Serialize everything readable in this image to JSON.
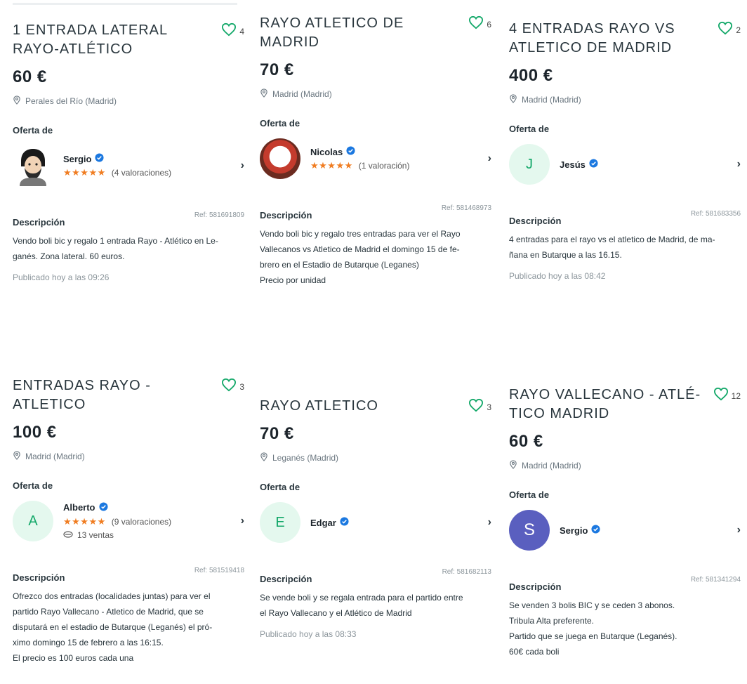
{
  "listings": [
    {
      "title": "1 ENTRADA LATERAL RAYO-ATLÉTICO",
      "favorites": "4",
      "price": "60 €",
      "location": "Perales del Río (Madrid)",
      "offer_label": "Oferta de",
      "seller": {
        "name": "Sergio",
        "avatar_letter": "",
        "avatar_icon": "user-photo",
        "stars": "★★★★★",
        "ratings": "(4 valoraciones)",
        "sales": ""
      },
      "description_label": "Descripción",
      "ref": "Ref: 581691809",
      "description": "Vendo boli bic y regalo 1 entrada Rayo - Atlético en Le-\nganés. Zona lateral. 60 euros.",
      "published": "Publicado hoy a las 09:26"
    },
    {
      "title": "RAYO ATLETICO DE MADRID",
      "favorites": "6",
      "price": "70 €",
      "location": "Madrid (Madrid)",
      "offer_label": "Oferta de",
      "seller": {
        "name": "Nicolas",
        "avatar_letter": "",
        "avatar_icon": "jersey-photo",
        "stars": "★★★★★",
        "ratings": "(1 valoración)",
        "sales": ""
      },
      "description_label": "Descripción",
      "ref": "Ref: 581468973",
      "description": "Vendo boli bic y regalo tres entradas para ver el Rayo\nVallecanos vs Atletico de Madrid el domingo 15 de fe-\nbrero en el Estadio de Butarque (Leganes)\nPrecio por unidad",
      "published": ""
    },
    {
      "title": "4 ENTRADAS RAYO VS ATLETICO DE MADRID",
      "favorites": "2",
      "price": "400 €",
      "location": "Madrid (Madrid)",
      "offer_label": "Oferta de",
      "seller": {
        "name": "Jesús",
        "avatar_letter": "J",
        "avatar_icon": "",
        "stars": "",
        "ratings": "",
        "sales": ""
      },
      "description_label": "Descripción",
      "ref": "Ref: 581683356",
      "description": "4 entradas para el rayo vs el atletico de Madrid, de ma-\nñana en Butarque a las 16.15.",
      "published": "Publicado hoy a las 08:42"
    },
    {
      "title": "ENTRADAS RAYO - ATLETICO",
      "favorites": "3",
      "price": "100 €",
      "location": "Madrid (Madrid)",
      "offer_label": "Oferta de",
      "seller": {
        "name": "Alberto",
        "avatar_letter": "A",
        "avatar_icon": "",
        "stars": "★★★★★",
        "ratings": "(9 valoraciones)",
        "sales": "13 ventas"
      },
      "description_label": "Descripción",
      "ref": "Ref: 581519418",
      "description": "Ofrezco dos entradas (localidades juntas) para ver el\npartido Rayo Vallecano - Atletico de Madrid, que se\ndisputará en el estadio de Butarque (Leganés) el pró-\nximo domingo 15 de febrero a las 16:15.\nEl precio es 100 euros cada una",
      "published": ""
    },
    {
      "title": "RAYO ATLETICO",
      "favorites": "3",
      "price": "70 €",
      "location": "Leganés (Madrid)",
      "offer_label": "Oferta de",
      "seller": {
        "name": "Edgar",
        "avatar_letter": "E",
        "avatar_icon": "",
        "stars": "",
        "ratings": "",
        "sales": ""
      },
      "description_label": "Descripción",
      "ref": "Ref: 581682113",
      "description": "Se vende boli y se regala entrada para el partido entre\nel Rayo Vallecano y el Atlético de Madrid",
      "published": "Publicado hoy a las 08:33"
    },
    {
      "title": "RAYO VALLECANO - ATLÉ-TICO MADRID",
      "favorites": "12",
      "price": "60 €",
      "location": "Madrid (Madrid)",
      "offer_label": "Oferta de",
      "seller": {
        "name": "Sergio",
        "avatar_letter": "S",
        "avatar_icon": "",
        "stars": "",
        "ratings": "",
        "sales": ""
      },
      "description_label": "Descripción",
      "ref": "Ref: 581341294",
      "description": "Se venden 3 bolis BIC y se ceden 3 abonos.\nTribula Alta preferente.\nPartido que se juega en Butarque (Leganés).\n60€ cada boli",
      "published": ""
    }
  ],
  "colors": {
    "accent_green": "#13a869",
    "star_orange": "#f07d22",
    "verified_blue": "#1b78e0",
    "avatar_purple": "#5a5fbf"
  },
  "icons": {
    "favorite": "heart-outline-icon",
    "location": "location-pin-icon",
    "verified": "verified-badge-icon",
    "chevron": "chevron-right-icon",
    "sales": "handshake-icon"
  }
}
